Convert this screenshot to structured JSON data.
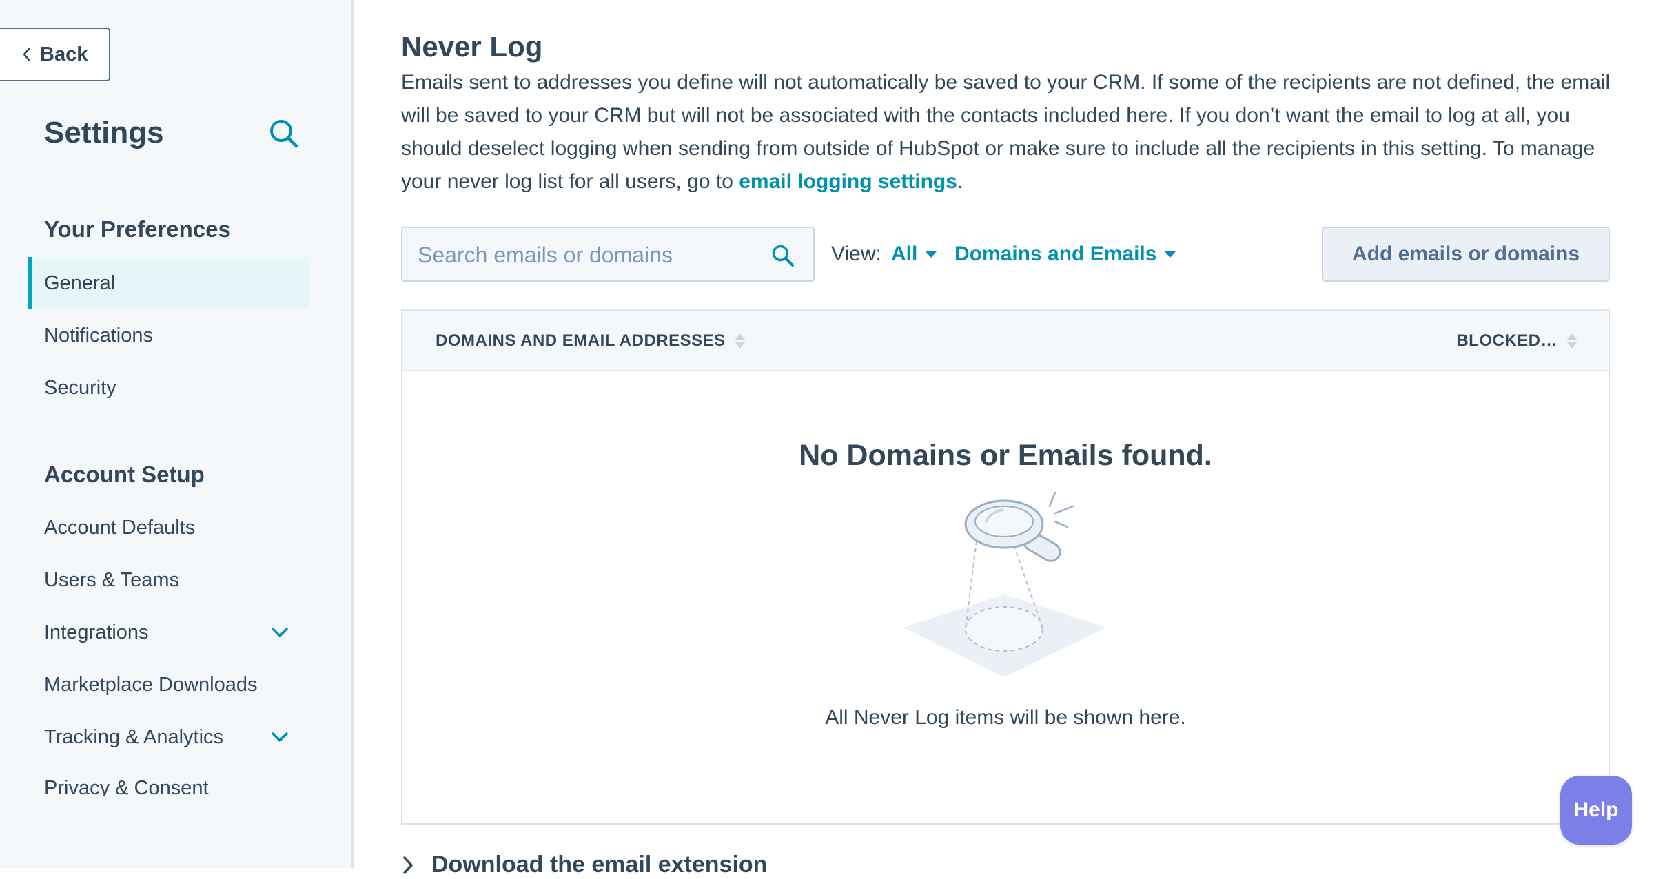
{
  "sidebar": {
    "back_label": "Back",
    "title": "Settings",
    "sections": [
      {
        "title": "Your Preferences",
        "items": [
          {
            "label": "General",
            "active": true
          },
          {
            "label": "Notifications"
          },
          {
            "label": "Security"
          }
        ]
      },
      {
        "title": "Account Setup",
        "items": [
          {
            "label": "Account Defaults"
          },
          {
            "label": "Users & Teams"
          },
          {
            "label": "Integrations",
            "expandable": true
          },
          {
            "label": "Marketplace Downloads"
          },
          {
            "label": "Tracking & Analytics",
            "expandable": true
          },
          {
            "label": "Privacy & Consent"
          }
        ]
      }
    ]
  },
  "main": {
    "title": "Never Log",
    "description": "Emails sent to addresses you define will not automatically be saved to your CRM. If some of the recipients are not defined, the email will be saved to your CRM but will not be associated with the contacts included here. If you don’t want the email to log at all, you should deselect logging when sending from outside of HubSpot or make sure to include all the recipients in this setting. To manage your never log list for all users, go to ",
    "description_link": "email logging settings",
    "description_end": ".",
    "search": {
      "placeholder": "Search emails or domains",
      "value": ""
    },
    "view_label": "View:",
    "view_filter": "All",
    "type_filter": "Domains and Emails",
    "add_button": "Add emails or domains",
    "table": {
      "columns": [
        "DOMAINS AND EMAIL ADDRESSES",
        "BLOCKED…"
      ],
      "rows": [],
      "empty_title": "No Domains or Emails found.",
      "empty_subtitle": "All Never Log items will be shown here."
    },
    "download_extension": "Download the email extension"
  },
  "help_label": "Help",
  "colors": {
    "accent": "#0091ae",
    "active_bar": "#00a4bd",
    "text": "#33475b",
    "help": "#7b7fe6"
  }
}
